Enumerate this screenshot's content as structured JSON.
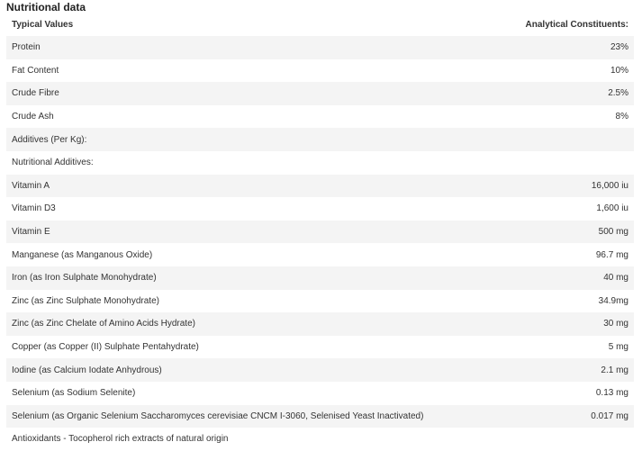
{
  "section_title": "Nutritional data",
  "table": {
    "headers": {
      "label": "Typical Values",
      "value": "Analytical Constituents:"
    },
    "rows": [
      {
        "label": "Protein",
        "value": "23%"
      },
      {
        "label": "Fat Content",
        "value": "10%"
      },
      {
        "label": "Crude Fibre",
        "value": "2.5%"
      },
      {
        "label": "Crude Ash",
        "value": "8%"
      },
      {
        "label": "Additives (Per Kg):",
        "value": ""
      },
      {
        "label": "Nutritional Additives:",
        "value": ""
      },
      {
        "label": "Vitamin A",
        "value": "16,000 iu"
      },
      {
        "label": "Vitamin D3",
        "value": "1,600 iu"
      },
      {
        "label": "Vitamin E",
        "value": "500 mg"
      },
      {
        "label": "Manganese (as Manganous Oxide)",
        "value": "96.7 mg"
      },
      {
        "label": "Iron (as Iron Sulphate Monohydrate)",
        "value": "40 mg"
      },
      {
        "label": "Zinc (as Zinc Sulphate Monohydrate)",
        "value": "34.9mg"
      },
      {
        "label": "Zinc (as Zinc Chelate of Amino Acids Hydrate)",
        "value": "30 mg"
      },
      {
        "label": "Copper (as Copper (II) Sulphate Pentahydrate)",
        "value": "5 mg"
      },
      {
        "label": "Iodine (as Calcium Iodate Anhydrous)",
        "value": "2.1 mg"
      },
      {
        "label": "Selenium (as Sodium Selenite)",
        "value": "0.13 mg"
      },
      {
        "label": "Selenium (as Organic Selenium Saccharomyces cerevisiae CNCM I-3060, Selenised Yeast Inactivated)",
        "value": "0.017 mg"
      },
      {
        "label": "Antioxidants - Tocopherol rich extracts of natural origin",
        "value": ""
      }
    ]
  }
}
